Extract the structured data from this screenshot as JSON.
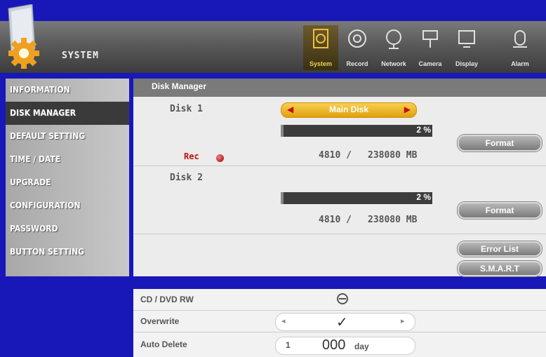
{
  "header": {
    "system_title": "SYSTEM",
    "top_buttons": [
      {
        "label": "System",
        "icon": "system-icon",
        "active": true
      },
      {
        "label": "Record",
        "icon": "record-icon",
        "active": false
      },
      {
        "label": "Network",
        "icon": "network-icon",
        "active": false
      },
      {
        "label": "Camera",
        "icon": "camera-icon",
        "active": false
      },
      {
        "label": "Display",
        "icon": "display-icon",
        "active": false
      },
      {
        "label": "Alarm",
        "icon": "alarm-icon",
        "active": false
      }
    ]
  },
  "sidebar": {
    "items": [
      {
        "label": "INFORMATION",
        "active": false
      },
      {
        "label": "DISK MANAGER",
        "active": true
      },
      {
        "label": "DEFAULT SETTING",
        "active": false
      },
      {
        "label": "TIME / DATE",
        "active": false
      },
      {
        "label": "UPGRADE",
        "active": false
      },
      {
        "label": "CONFIGURATION",
        "active": false
      },
      {
        "label": "PASSWORD",
        "active": false
      },
      {
        "label": "BUTTON SETTING",
        "active": false
      }
    ]
  },
  "disk_manager": {
    "title": "Disk Manager",
    "disks": [
      {
        "name": "Disk 1",
        "mode": "Main Disk",
        "usage_pct": "2 %",
        "used": "4810 /",
        "total": "238080 MB",
        "rec_label": "Rec",
        "format_label": "Format"
      },
      {
        "name": "Disk 2",
        "usage_pct": "2 %",
        "used": "4810 /",
        "total": "238080 MB",
        "format_label": "Format"
      }
    ],
    "error_list_label": "Error List",
    "smart_label": "S.M.A.R.T"
  },
  "bottom": {
    "cd_label": "CD / DVD RW",
    "overwrite_label": "Overwrite",
    "overwrite_value": "✓",
    "auto_delete_label": "Auto Delete",
    "auto_delete_value": "000",
    "auto_delete_unit": "day",
    "auto_delete_prefix": "1"
  },
  "colors": {
    "background": "#1818b8",
    "accent": "#f0c030",
    "rec": "#c01010"
  }
}
